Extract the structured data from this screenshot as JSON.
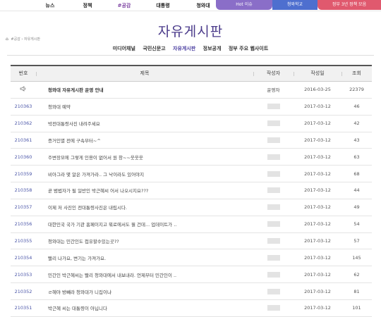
{
  "topnav": {
    "items": [
      "뉴스",
      "정책",
      "#공감",
      "대통령",
      "청와대"
    ],
    "active": "#공감",
    "hot_links": [
      "Hot 이슈",
      "청와학교",
      "정부 3년 정책 모음"
    ]
  },
  "page": {
    "title": "자유게시판",
    "breadcrumb": "#공감 › 자유게시판"
  },
  "subnav": {
    "items": [
      "미디어채널",
      "국민신문고",
      "자유게시판",
      "정보공개",
      "정부 주요 웹사이트"
    ],
    "active": "자유게시판"
  },
  "table": {
    "headers": {
      "no": "번호",
      "title": "제목",
      "author": "작성자",
      "date": "작성일",
      "views": "조회"
    },
    "notice": {
      "icon": "megaphone-icon",
      "title": "청와대 자유게시판 운영 안내",
      "author": "운영자",
      "date": "2016-03-25",
      "views": "22379"
    },
    "rows": [
      {
        "no": "210363",
        "title": "청와대 예약",
        "date": "2017-03-12",
        "views": "46"
      },
      {
        "no": "210362",
        "title": "박전대통령사진 내려주세요",
        "date": "2017-03-12",
        "views": "42"
      },
      {
        "no": "210361",
        "title": "증거인멸 전에 구속부터~^",
        "date": "2017-03-12",
        "views": "43"
      },
      {
        "no": "210360",
        "title": "주변장모에 그렇게 인용이 없어서 원 창~~웃웃웃",
        "date": "2017-03-12",
        "views": "63"
      },
      {
        "no": "210359",
        "title": "비아그라 몇 알은 가져가라.. 그 낙이라도 있어야지",
        "date": "2017-03-12",
        "views": "68"
      },
      {
        "no": "210358",
        "title": "곧 범법자가 될 일반인 박근혜씨 어서 나오시지요???",
        "date": "2017-03-12",
        "views": "44"
      },
      {
        "no": "210357",
        "title": "이제 저 사진인 전대통령사진은 내립시다.",
        "date": "2017-03-12",
        "views": "49"
      },
      {
        "no": "210356",
        "title": "대한민국 국가 기관 홈페이지고 뭐로에서도 뭘 건데... 업데이트가 ..",
        "date": "2017-03-12",
        "views": "54"
      },
      {
        "no": "210355",
        "title": "청와대는 민간인도 접유할수있는곳??",
        "date": "2017-03-12",
        "views": "57"
      },
      {
        "no": "210354",
        "title": "빨리 나가요, 변기는 가져가요.",
        "date": "2017-03-12",
        "views": "145"
      },
      {
        "no": "210353",
        "title": "민간인 박근혜씨는 빨리 청와대에서 내보내라. 언제부터 민간인이 ..",
        "date": "2017-03-12",
        "views": "62"
      },
      {
        "no": "210352",
        "title": "ㄹ혜야 방빼라 청와대가 니집이냐",
        "date": "2017-03-12",
        "views": "81"
      },
      {
        "no": "210351",
        "title": "박근혜 씨는 대통령이 아닙니다",
        "date": "2017-03-12",
        "views": "101"
      }
    ]
  }
}
